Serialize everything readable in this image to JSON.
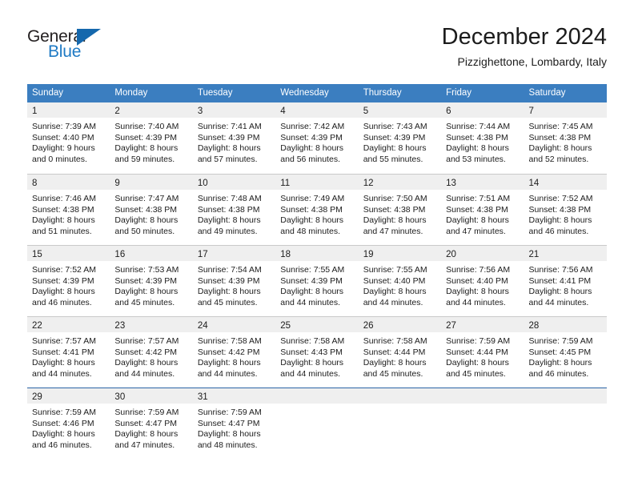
{
  "brand": {
    "name_part1": "General",
    "name_part2": "Blue",
    "triangle_icon": "triangle-icon",
    "color_dark": "#231f20",
    "color_blue": "#1f7ac4"
  },
  "header": {
    "title": "December 2024",
    "subtitle": "Pizzighettone, Lombardy, Italy"
  },
  "theme": {
    "header_band": "#3b7ec0",
    "day_strip": "#efefef",
    "row_divider": "#c9c9c9",
    "last_row_divider": "#2a63a5"
  },
  "weekdays": [
    "Sunday",
    "Monday",
    "Tuesday",
    "Wednesday",
    "Thursday",
    "Friday",
    "Saturday"
  ],
  "weeks": [
    [
      {
        "day": "1",
        "sunrise": "Sunrise: 7:39 AM",
        "sunset": "Sunset: 4:40 PM",
        "daylight1": "Daylight: 9 hours",
        "daylight2": "and 0 minutes."
      },
      {
        "day": "2",
        "sunrise": "Sunrise: 7:40 AM",
        "sunset": "Sunset: 4:39 PM",
        "daylight1": "Daylight: 8 hours",
        "daylight2": "and 59 minutes."
      },
      {
        "day": "3",
        "sunrise": "Sunrise: 7:41 AM",
        "sunset": "Sunset: 4:39 PM",
        "daylight1": "Daylight: 8 hours",
        "daylight2": "and 57 minutes."
      },
      {
        "day": "4",
        "sunrise": "Sunrise: 7:42 AM",
        "sunset": "Sunset: 4:39 PM",
        "daylight1": "Daylight: 8 hours",
        "daylight2": "and 56 minutes."
      },
      {
        "day": "5",
        "sunrise": "Sunrise: 7:43 AM",
        "sunset": "Sunset: 4:39 PM",
        "daylight1": "Daylight: 8 hours",
        "daylight2": "and 55 minutes."
      },
      {
        "day": "6",
        "sunrise": "Sunrise: 7:44 AM",
        "sunset": "Sunset: 4:38 PM",
        "daylight1": "Daylight: 8 hours",
        "daylight2": "and 53 minutes."
      },
      {
        "day": "7",
        "sunrise": "Sunrise: 7:45 AM",
        "sunset": "Sunset: 4:38 PM",
        "daylight1": "Daylight: 8 hours",
        "daylight2": "and 52 minutes."
      }
    ],
    [
      {
        "day": "8",
        "sunrise": "Sunrise: 7:46 AM",
        "sunset": "Sunset: 4:38 PM",
        "daylight1": "Daylight: 8 hours",
        "daylight2": "and 51 minutes."
      },
      {
        "day": "9",
        "sunrise": "Sunrise: 7:47 AM",
        "sunset": "Sunset: 4:38 PM",
        "daylight1": "Daylight: 8 hours",
        "daylight2": "and 50 minutes."
      },
      {
        "day": "10",
        "sunrise": "Sunrise: 7:48 AM",
        "sunset": "Sunset: 4:38 PM",
        "daylight1": "Daylight: 8 hours",
        "daylight2": "and 49 minutes."
      },
      {
        "day": "11",
        "sunrise": "Sunrise: 7:49 AM",
        "sunset": "Sunset: 4:38 PM",
        "daylight1": "Daylight: 8 hours",
        "daylight2": "and 48 minutes."
      },
      {
        "day": "12",
        "sunrise": "Sunrise: 7:50 AM",
        "sunset": "Sunset: 4:38 PM",
        "daylight1": "Daylight: 8 hours",
        "daylight2": "and 47 minutes."
      },
      {
        "day": "13",
        "sunrise": "Sunrise: 7:51 AM",
        "sunset": "Sunset: 4:38 PM",
        "daylight1": "Daylight: 8 hours",
        "daylight2": "and 47 minutes."
      },
      {
        "day": "14",
        "sunrise": "Sunrise: 7:52 AM",
        "sunset": "Sunset: 4:38 PM",
        "daylight1": "Daylight: 8 hours",
        "daylight2": "and 46 minutes."
      }
    ],
    [
      {
        "day": "15",
        "sunrise": "Sunrise: 7:52 AM",
        "sunset": "Sunset: 4:39 PM",
        "daylight1": "Daylight: 8 hours",
        "daylight2": "and 46 minutes."
      },
      {
        "day": "16",
        "sunrise": "Sunrise: 7:53 AM",
        "sunset": "Sunset: 4:39 PM",
        "daylight1": "Daylight: 8 hours",
        "daylight2": "and 45 minutes."
      },
      {
        "day": "17",
        "sunrise": "Sunrise: 7:54 AM",
        "sunset": "Sunset: 4:39 PM",
        "daylight1": "Daylight: 8 hours",
        "daylight2": "and 45 minutes."
      },
      {
        "day": "18",
        "sunrise": "Sunrise: 7:55 AM",
        "sunset": "Sunset: 4:39 PM",
        "daylight1": "Daylight: 8 hours",
        "daylight2": "and 44 minutes."
      },
      {
        "day": "19",
        "sunrise": "Sunrise: 7:55 AM",
        "sunset": "Sunset: 4:40 PM",
        "daylight1": "Daylight: 8 hours",
        "daylight2": "and 44 minutes."
      },
      {
        "day": "20",
        "sunrise": "Sunrise: 7:56 AM",
        "sunset": "Sunset: 4:40 PM",
        "daylight1": "Daylight: 8 hours",
        "daylight2": "and 44 minutes."
      },
      {
        "day": "21",
        "sunrise": "Sunrise: 7:56 AM",
        "sunset": "Sunset: 4:41 PM",
        "daylight1": "Daylight: 8 hours",
        "daylight2": "and 44 minutes."
      }
    ],
    [
      {
        "day": "22",
        "sunrise": "Sunrise: 7:57 AM",
        "sunset": "Sunset: 4:41 PM",
        "daylight1": "Daylight: 8 hours",
        "daylight2": "and 44 minutes."
      },
      {
        "day": "23",
        "sunrise": "Sunrise: 7:57 AM",
        "sunset": "Sunset: 4:42 PM",
        "daylight1": "Daylight: 8 hours",
        "daylight2": "and 44 minutes."
      },
      {
        "day": "24",
        "sunrise": "Sunrise: 7:58 AM",
        "sunset": "Sunset: 4:42 PM",
        "daylight1": "Daylight: 8 hours",
        "daylight2": "and 44 minutes."
      },
      {
        "day": "25",
        "sunrise": "Sunrise: 7:58 AM",
        "sunset": "Sunset: 4:43 PM",
        "daylight1": "Daylight: 8 hours",
        "daylight2": "and 44 minutes."
      },
      {
        "day": "26",
        "sunrise": "Sunrise: 7:58 AM",
        "sunset": "Sunset: 4:44 PM",
        "daylight1": "Daylight: 8 hours",
        "daylight2": "and 45 minutes."
      },
      {
        "day": "27",
        "sunrise": "Sunrise: 7:59 AM",
        "sunset": "Sunset: 4:44 PM",
        "daylight1": "Daylight: 8 hours",
        "daylight2": "and 45 minutes."
      },
      {
        "day": "28",
        "sunrise": "Sunrise: 7:59 AM",
        "sunset": "Sunset: 4:45 PM",
        "daylight1": "Daylight: 8 hours",
        "daylight2": "and 46 minutes."
      }
    ],
    [
      {
        "day": "29",
        "sunrise": "Sunrise: 7:59 AM",
        "sunset": "Sunset: 4:46 PM",
        "daylight1": "Daylight: 8 hours",
        "daylight2": "and 46 minutes."
      },
      {
        "day": "30",
        "sunrise": "Sunrise: 7:59 AM",
        "sunset": "Sunset: 4:47 PM",
        "daylight1": "Daylight: 8 hours",
        "daylight2": "and 47 minutes."
      },
      {
        "day": "31",
        "sunrise": "Sunrise: 7:59 AM",
        "sunset": "Sunset: 4:47 PM",
        "daylight1": "Daylight: 8 hours",
        "daylight2": "and 48 minutes."
      },
      {
        "day": "",
        "sunrise": "",
        "sunset": "",
        "daylight1": "",
        "daylight2": ""
      },
      {
        "day": "",
        "sunrise": "",
        "sunset": "",
        "daylight1": "",
        "daylight2": ""
      },
      {
        "day": "",
        "sunrise": "",
        "sunset": "",
        "daylight1": "",
        "daylight2": ""
      },
      {
        "day": "",
        "sunrise": "",
        "sunset": "",
        "daylight1": "",
        "daylight2": ""
      }
    ]
  ]
}
